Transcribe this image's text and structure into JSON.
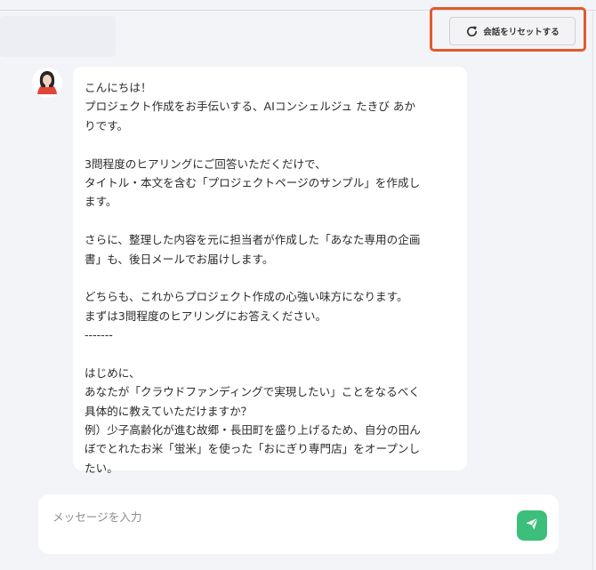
{
  "header": {
    "reset_button_label": "会話をリセットする",
    "reset_icon": "refresh-icon",
    "highlight_color": "#e35a2c"
  },
  "assistant": {
    "avatar_icon": "assistant-avatar",
    "message_lines": [
      "こんにちは！",
      "プロジェクト作成をお手伝いする、AIコンシェルジュ たきび あか",
      "りです。",
      "",
      "3問程度のヒアリングにご回答いただくだけで、",
      "タイトル・本文を含む「プロジェクトページのサンプル」を作成し",
      "ます。",
      "",
      "さらに、整理した内容を元に担当者が作成した「あなた専用の企画",
      "書」も、後日メールでお届けします。",
      "",
      "どちらも、これからプロジェクト作成の心強い味方になります。",
      "まずは3問程度のヒアリングにお答えください。",
      "-------",
      "",
      "はじめに、",
      "あなたが「クラウドファンディングで実現したい」ことをなるべく",
      "具体的に教えていただけますか？",
      "例）少子高齢化が進む故郷・長田町を盛り上げるため、自分の田ん",
      "ぼでとれたお米「蛍米」を使った「おにぎり専門店」をオープンし",
      "たい。"
    ]
  },
  "composer": {
    "placeholder": "メッセージを入力",
    "value": "",
    "send_icon": "send-icon",
    "send_color": "#3bbf7b"
  }
}
